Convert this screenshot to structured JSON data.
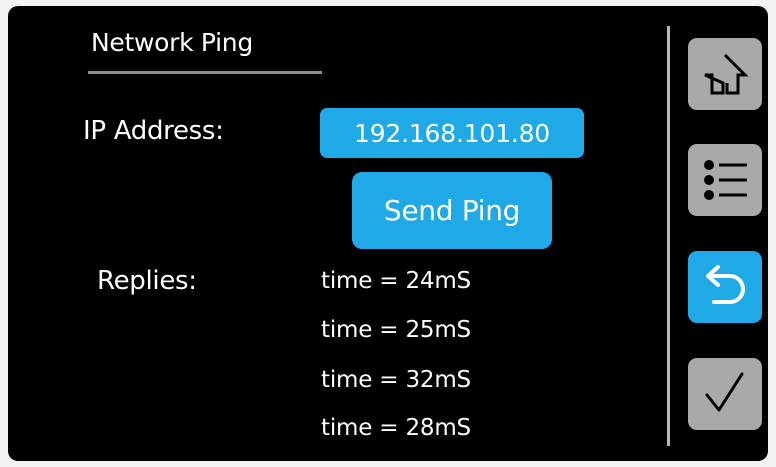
{
  "screen": {
    "title": "Network Ping",
    "ip_label": "IP Address:",
    "ip_value": "192.168.101.80",
    "send_label": "Send Ping",
    "replies_label": "Replies:",
    "replies": [
      "time = 24mS",
      "time = 25mS",
      "time = 32mS",
      "time = 28mS"
    ]
  },
  "nav": {
    "icons": [
      "home-icon",
      "list-icon",
      "back-icon",
      "checkmark-icon"
    ],
    "active": "back-icon"
  },
  "colors": {
    "accent": "#1fa9e6",
    "button_gray": "#a9a9a9",
    "background": "#000000",
    "text": "#ffffff"
  }
}
